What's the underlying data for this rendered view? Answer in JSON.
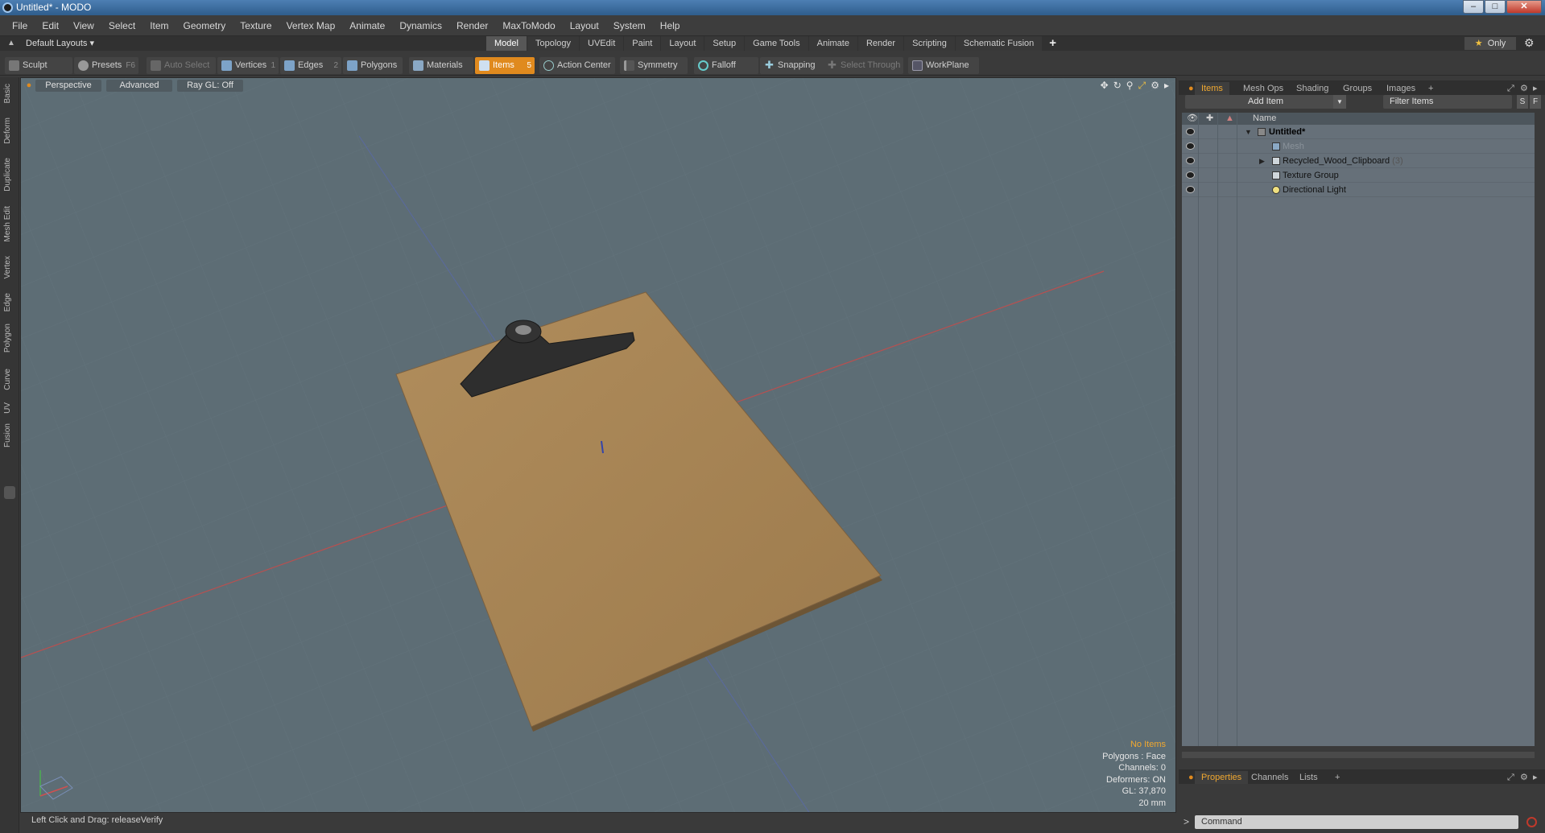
{
  "window": {
    "title": "Untitled* - MODO"
  },
  "menu": [
    "File",
    "Edit",
    "View",
    "Select",
    "Item",
    "Geometry",
    "Texture",
    "Vertex Map",
    "Animate",
    "Dynamics",
    "Render",
    "MaxToModo",
    "Layout",
    "System",
    "Help"
  ],
  "layouts": {
    "label": "Default Layouts ▾"
  },
  "tabs": [
    "Model",
    "Topology",
    "UVEdit",
    "Paint",
    "Layout",
    "Setup",
    "Game Tools",
    "Animate",
    "Render",
    "Scripting",
    "Schematic Fusion"
  ],
  "tabs_active": "Model",
  "only_btn": {
    "star": "★",
    "label": "Only"
  },
  "toolbar": {
    "sculpt": "Sculpt",
    "presets": "Presets",
    "presets_key": "F6",
    "auto_select": "Auto Select",
    "vertices": "Vertices",
    "vertices_key": "1",
    "edges": "Edges",
    "edges_key": "2",
    "polygons": "Polygons",
    "materials": "Materials",
    "items": "Items",
    "items_key": "5",
    "action_center": "Action Center",
    "symmetry": "Symmetry",
    "falloff": "Falloff",
    "snapping": "Snapping",
    "select_through": "Select Through",
    "workplane": "WorkPlane"
  },
  "left_strip": [
    "Basic",
    "Deform",
    "Duplicate",
    "Mesh Edit",
    "Vertex",
    "Edge",
    "Polygon",
    "Curve",
    "UV",
    "Fusion"
  ],
  "viewport": {
    "perspective": "Perspective",
    "advanced": "Advanced",
    "raygl": "Ray GL: Off",
    "stats": {
      "no_items": "No Items",
      "polygons": "Polygons : Face",
      "channels": "Channels: 0",
      "deformers": "Deformers: ON",
      "gl": "GL: 37,870",
      "scale": "20 mm"
    }
  },
  "status": {
    "text": "Left Click and Drag:   releaseVerify"
  },
  "right_panel": {
    "tabs": [
      "Items",
      "Mesh Ops",
      "Shading",
      "Groups",
      "Images"
    ],
    "add_item": "Add Item",
    "filter": "Filter Items",
    "s_btn": "S",
    "f_btn": "F",
    "col_name": "Name",
    "items": [
      {
        "name": "Untitled*",
        "count": ""
      },
      {
        "name": "Mesh",
        "count": ""
      },
      {
        "name": "Recycled_Wood_Clipboard",
        "count": "(3)"
      },
      {
        "name": "Texture Group",
        "count": ""
      },
      {
        "name": "Directional Light",
        "count": ""
      }
    ],
    "bottom_tabs": [
      "Properties",
      "Channels",
      "Lists"
    ],
    "command_placeholder": "Command",
    "prompt": ">"
  },
  "colors": {
    "accent": "#e08a1e",
    "viewport_bg": "#5d6d75",
    "clipboard": "#a88657",
    "clip": "#2e2e2e"
  }
}
